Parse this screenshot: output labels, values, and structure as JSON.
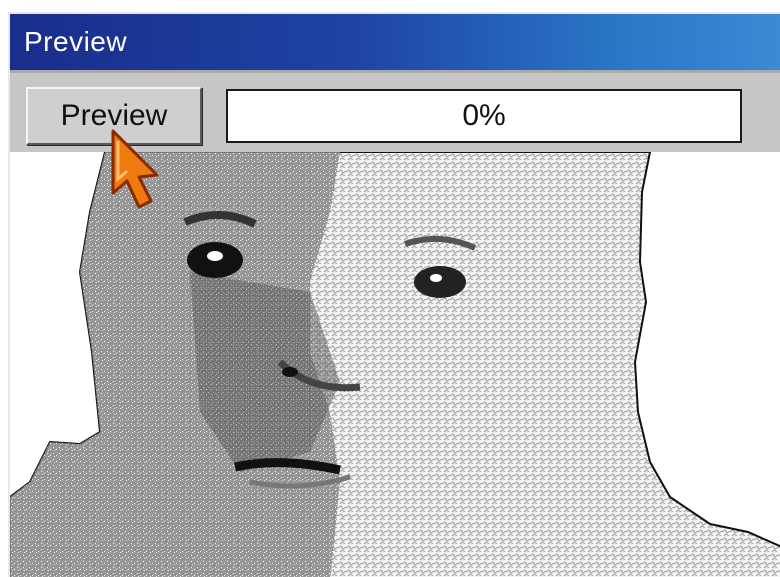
{
  "window": {
    "title": "Preview",
    "title_bar_color": "#1e44a4"
  },
  "toolbar": {
    "preview_button_label": "Preview",
    "progress": {
      "text": "0%",
      "value": 0
    }
  },
  "preview_area": {
    "content": "halftone-face-image"
  },
  "cursor": {
    "icon": "arrow-pointer-icon",
    "color": "#f07a10"
  }
}
